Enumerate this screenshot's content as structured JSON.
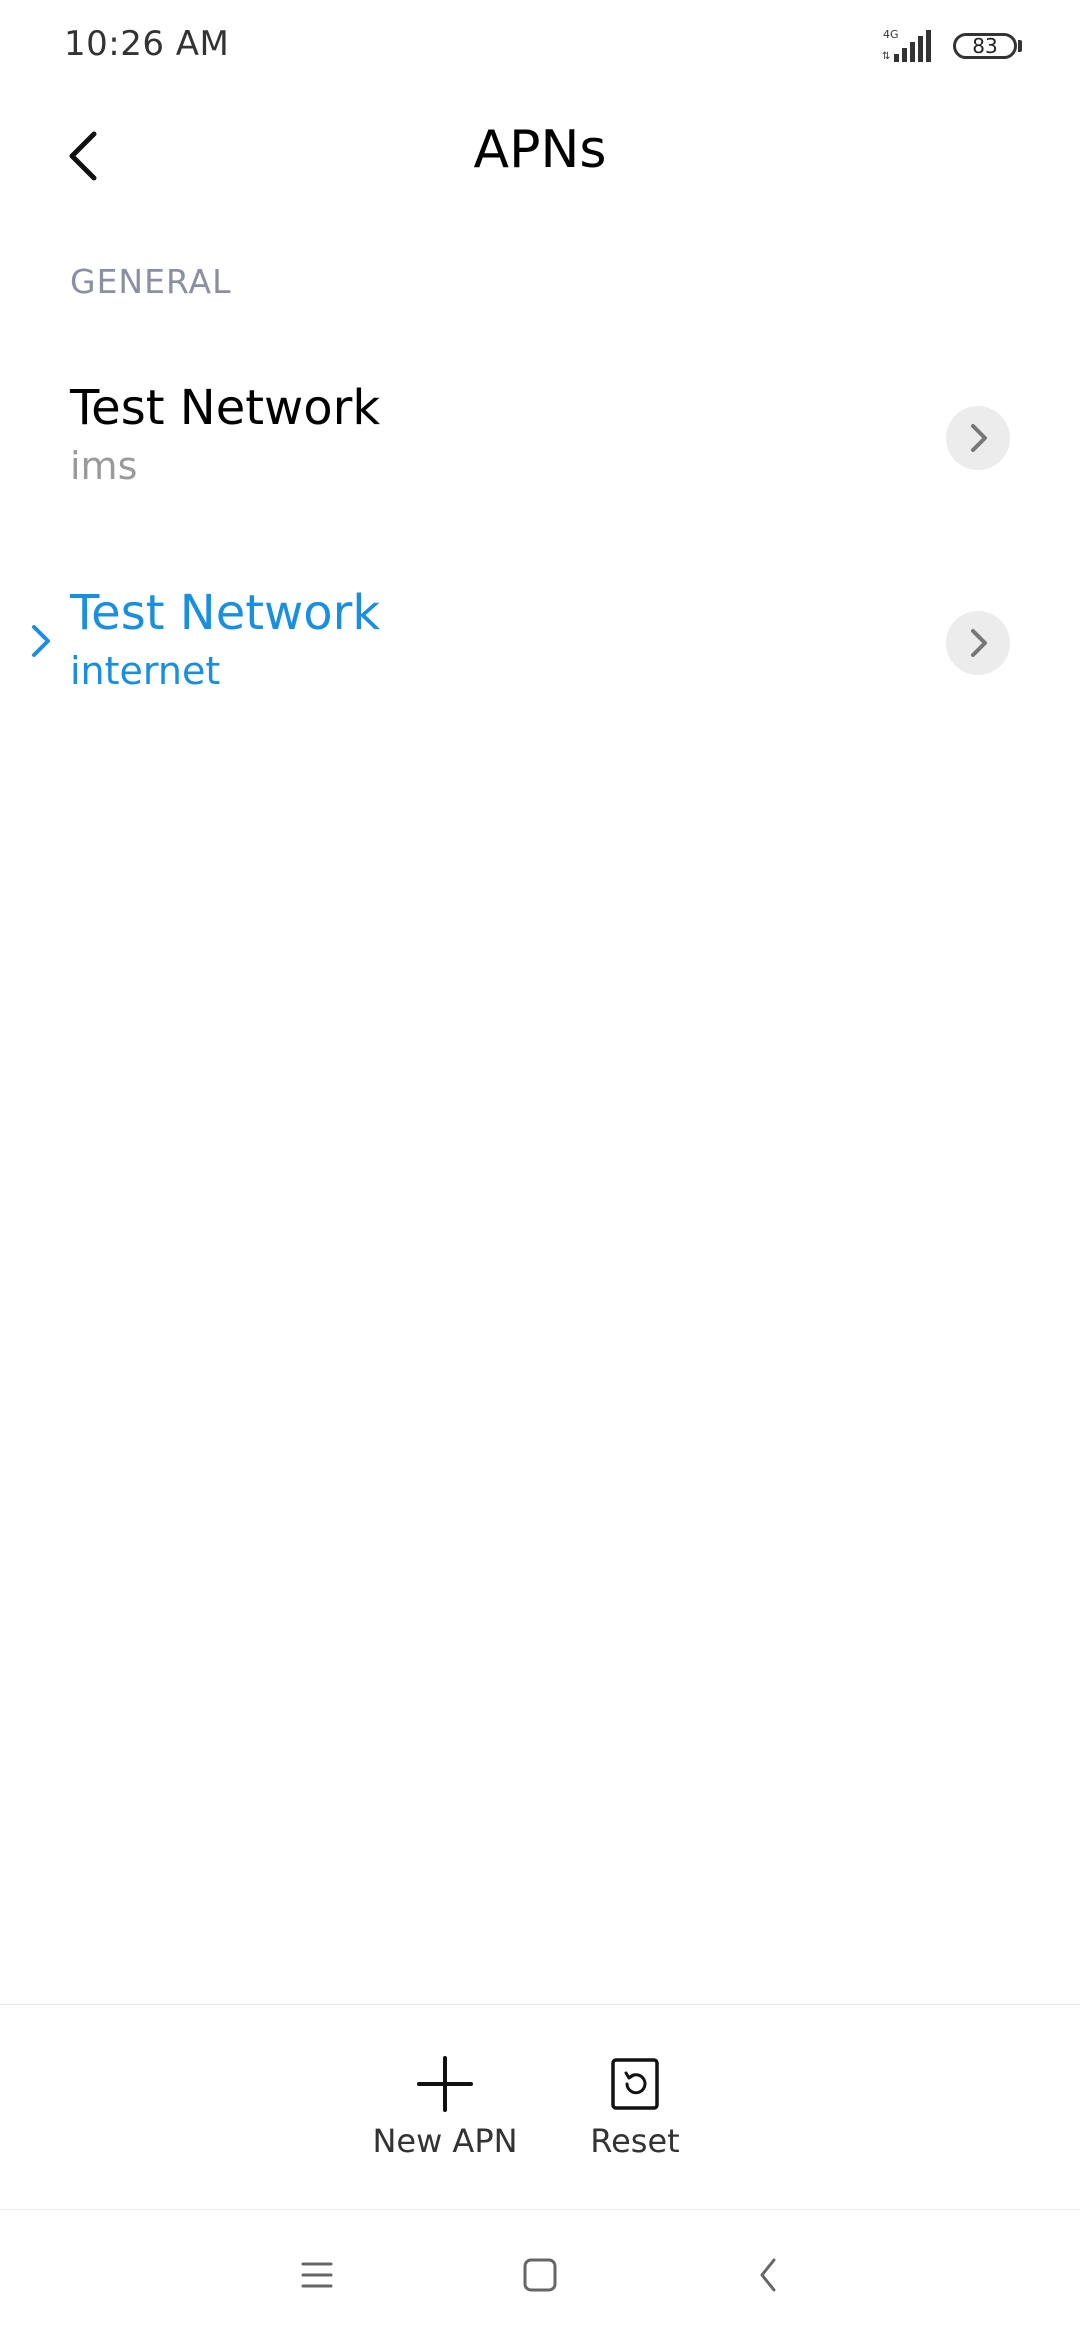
{
  "status_bar": {
    "time": "10:26 AM",
    "network_type": "4G",
    "battery_level": "83"
  },
  "header": {
    "title": "APNs",
    "back_icon": "back-arrow-icon"
  },
  "section": {
    "label": "GENERAL"
  },
  "apns": [
    {
      "name": "Test Network",
      "type": "ims",
      "selected": false
    },
    {
      "name": "Test Network",
      "type": "internet",
      "selected": true
    }
  ],
  "actions": {
    "new_apn_label": "New APN",
    "reset_label": "Reset"
  },
  "colors": {
    "accent": "#1a8fe0",
    "section_label": "#8a8fa3",
    "secondary_text": "#9a9a9a"
  }
}
